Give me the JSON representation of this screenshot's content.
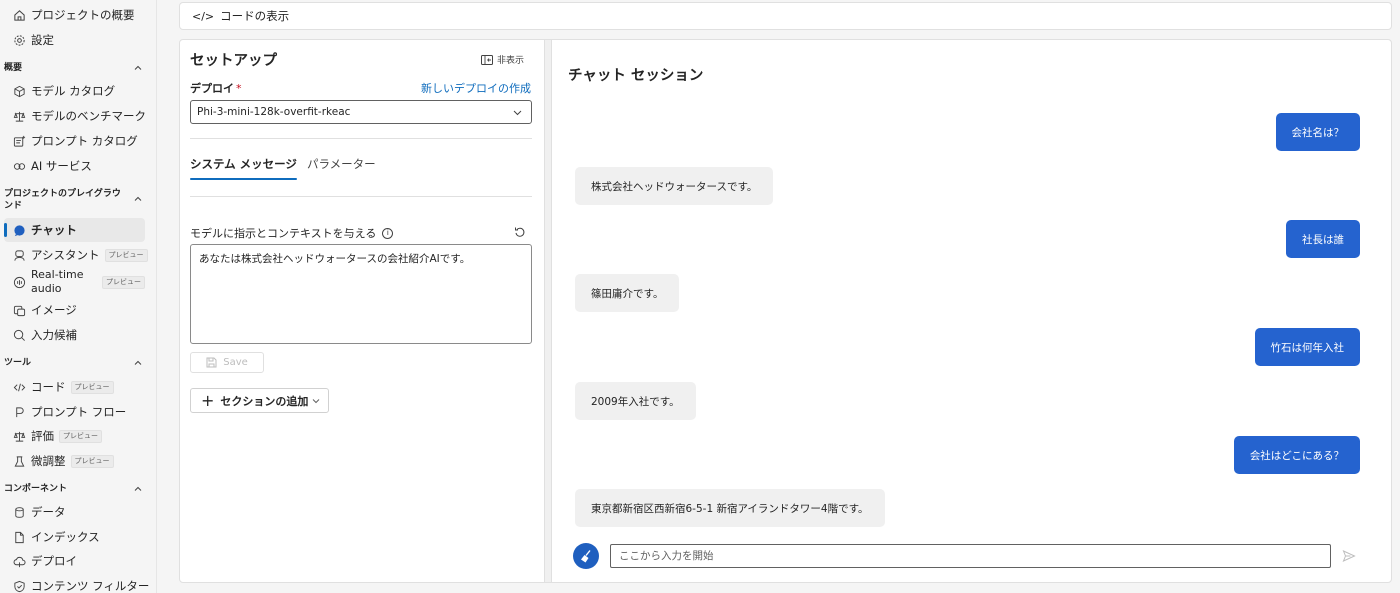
{
  "sidebar": {
    "top_items": [
      {
        "label": "プロジェクトの概要",
        "icon": "home-icon"
      },
      {
        "label": "設定",
        "icon": "gear-icon"
      }
    ],
    "sections": [
      {
        "title": "概要",
        "items": [
          {
            "label": "モデル カタログ",
            "icon": "cube-icon",
            "badge": ""
          },
          {
            "label": "モデルのベンチマーク",
            "icon": "scale-icon",
            "badge": ""
          },
          {
            "label": "プロンプト カタログ",
            "icon": "prompt-icon",
            "badge": ""
          },
          {
            "label": "AI サービス",
            "icon": "link-icon",
            "badge": ""
          }
        ]
      },
      {
        "title": "プロジェクトのプレイグラウンド",
        "items": [
          {
            "label": "チャット",
            "icon": "chat-icon",
            "badge": "",
            "active": true
          },
          {
            "label": "アシスタント",
            "icon": "assistant-icon",
            "badge": "プレビュー"
          },
          {
            "label": "Real-time audio",
            "icon": "audio-icon",
            "badge": "プレビュー"
          },
          {
            "label": "イメージ",
            "icon": "image-icon",
            "badge": ""
          },
          {
            "label": "入力候補",
            "icon": "completion-icon",
            "badge": ""
          }
        ]
      },
      {
        "title": "ツール",
        "items": [
          {
            "label": "コード",
            "icon": "code-icon",
            "badge": "プレビュー"
          },
          {
            "label": "プロンプト フロー",
            "icon": "flow-icon",
            "badge": ""
          },
          {
            "label": "評価",
            "icon": "evaluation-icon",
            "badge": "プレビュー"
          },
          {
            "label": "微調整",
            "icon": "flask-icon",
            "badge": "プレビュー"
          }
        ]
      },
      {
        "title": "コンポーネント",
        "items": [
          {
            "label": "データ",
            "icon": "database-icon",
            "badge": ""
          },
          {
            "label": "インデックス",
            "icon": "index-icon",
            "badge": ""
          },
          {
            "label": "デプロイ",
            "icon": "cloud-icon",
            "badge": ""
          },
          {
            "label": "コンテンツ フィルター",
            "icon": "shield-icon",
            "badge": ""
          }
        ]
      }
    ]
  },
  "topbar": {
    "code_label": "コードの表示"
  },
  "setup": {
    "title": "セットアップ",
    "hide_label": "非表示",
    "deploy_label": "デプロイ",
    "required_mark": "*",
    "new_deploy_link": "新しいデプロイの作成",
    "deploy_value": "Phi-3-mini-128k-overfit-rkeac",
    "tabs": [
      "システム メッセージ",
      "パラメーター"
    ],
    "system_label": "モデルに指示とコンテキストを与える",
    "system_message": "あなたは株式会社ヘッドウォータースの会社紹介AIです。",
    "save_label": "Save",
    "add_section_label": "セクションの追加"
  },
  "chat": {
    "title": "チャット セッション",
    "messages": [
      {
        "role": "user",
        "text": "会社名は？"
      },
      {
        "role": "assistant",
        "text": "株式会社ヘッドウォータースです。"
      },
      {
        "role": "user",
        "text": "社長は誰"
      },
      {
        "role": "assistant",
        "text": "篠田庸介です。"
      },
      {
        "role": "user",
        "text": "竹石は何年入社"
      },
      {
        "role": "assistant",
        "text": "2009年入社です。"
      },
      {
        "role": "user",
        "text": "会社はどこにある？"
      },
      {
        "role": "assistant",
        "text": "東京都新宿区西新宿6-5-1 新宿アイランドタワー4階です。"
      }
    ],
    "input_placeholder": "ここから入力を開始"
  }
}
